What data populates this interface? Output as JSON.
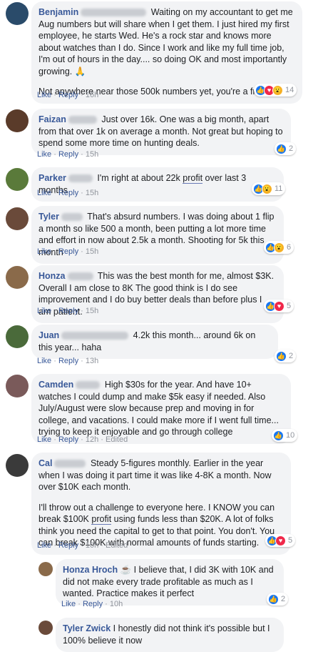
{
  "comments": [
    {
      "name": "Benjamin",
      "text": "Waiting on my accountant to get me Aug numbers but will share when I get them. I just hired my first employee, he starts Wed. He's a rock star and knows more about watches than I do. Since I work and like my full time job, I'm out of hours in the day.... so doing OK and most importantly growing. 🙏",
      "text2": "Not anywhere near those 500k numbers yet, you're a freak lol",
      "like": "Like",
      "reply": "Reply",
      "time": "16h",
      "edited": "",
      "reaction_count": "14",
      "avatar_color": "#2a4b6a"
    },
    {
      "name": "Faizan",
      "text": "Just over 16k. One was a big month, apart from that over 1k on average a month. Not great but hoping to spend some more time on hunting deals.",
      "like": "Like",
      "reply": "Reply",
      "time": "15h",
      "edited": "",
      "reaction_count": "2",
      "avatar_color": "#5a3b2a"
    },
    {
      "name": "Parker",
      "text_before": "I'm right at about 22k",
      "text_link": "profit",
      "text_after": "over last 3 months",
      "like": "Like",
      "reply": "Reply",
      "time": "15h",
      "edited": "",
      "reaction_count": "11",
      "avatar_color": "#5a7a3a"
    },
    {
      "name": "Tyler",
      "text": "That's absurd numbers. I was doing about 1 flip a month so like 500 a month, been putting a lot more time and effort in now about 2.5k a month. Shooting for 5k this month",
      "like": "Like",
      "reply": "Reply",
      "time": "15h",
      "edited": "",
      "reaction_count": "6",
      "avatar_color": "#6a4a3a"
    },
    {
      "name": "Honza",
      "text": "This was the best month for me, almost $3K. Overall I am close to 8K The good think is I do see improvement and I do buy better deals than before plus I am patient.",
      "like": "Like",
      "reply": "Reply",
      "time": "15h",
      "edited": "",
      "reaction_count": "5",
      "avatar_color": "#8a6a4a"
    },
    {
      "name": "Juan",
      "text": "4.2k this month... around 6k on this year... haha",
      "like": "Like",
      "reply": "Reply",
      "time": "13h",
      "edited": "",
      "reaction_count": "2",
      "avatar_color": "#4a6a3a"
    },
    {
      "name": "Camden",
      "text": "High $30s for the year. And have 10+ watches I could dump and make $5k easy if needed. Also July/August were slow because prep and moving in for college, and vacations. I could make more if I went full time... trying to keep it enjoyable and go through college",
      "like": "Like",
      "reply": "Reply",
      "time": "12h",
      "edited": "Edited",
      "reaction_count": "10",
      "avatar_color": "#7a5a5a"
    },
    {
      "name": "Cal",
      "text": "Steady 5-figures monthly. Earlier in the year when I was doing it part time it was like 4-8K a month. Now over $10K each month.",
      "text2_before": "I'll throw out a challenge to everyone here. I KNOW you can break $100K",
      "text2_link": "profit",
      "text2_after": "using funds less than $20K. A lot of folks think you need the capital to get to that point. You don't. You can break $100K with normal amounts of funds starting.",
      "like": "Like",
      "reply": "Reply",
      "time": "10h",
      "edited": "Edited",
      "reaction_count": "5",
      "avatar_color": "#3a3a3a"
    }
  ],
  "replies": [
    {
      "name": "Honza Hroch",
      "badge": "☕",
      "text": "I believe that, I did 3K with 10K and did not make every trade profitable as much as I wanted. Practice makes it perfect",
      "like": "Like",
      "reply": "Reply",
      "time": "10h",
      "reaction_count": "2",
      "avatar_color": "#8a6a4a"
    },
    {
      "name": "Tyler Zwick",
      "text": "I honestly did not think it's possible but I 100% believe it now",
      "avatar_color": "#6a4a3a"
    }
  ],
  "separator": "·"
}
